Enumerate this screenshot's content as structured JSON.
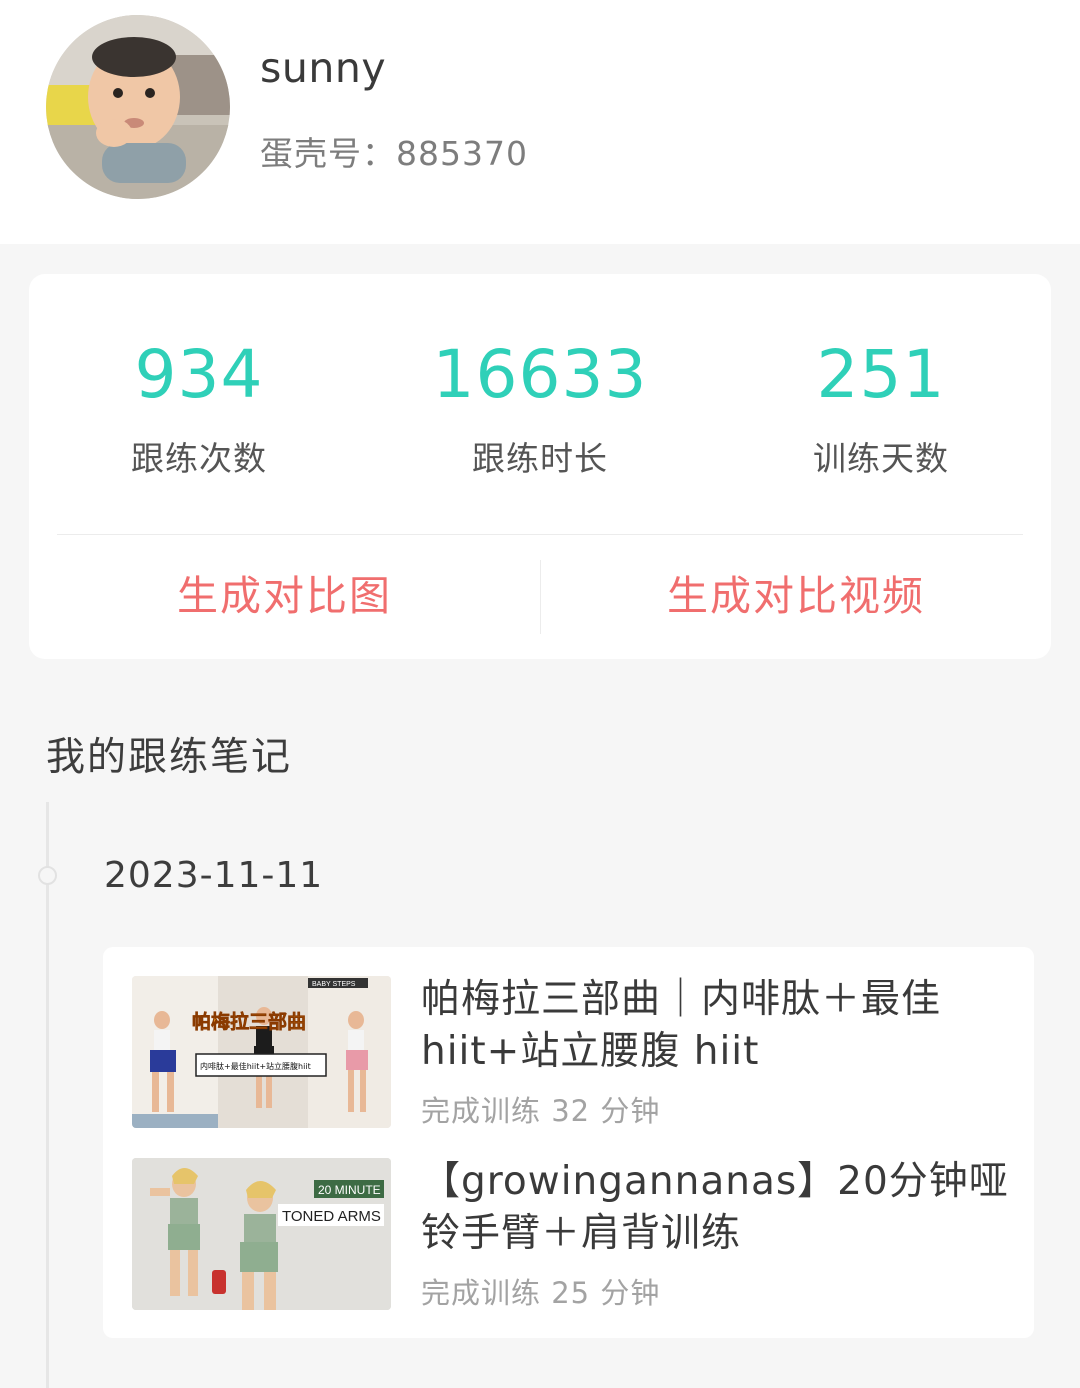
{
  "profile": {
    "username": "sunny",
    "id_text": "蛋壳号：885370"
  },
  "stats": [
    {
      "value": "934",
      "label": "跟练次数"
    },
    {
      "value": "16633",
      "label": "跟练时长"
    },
    {
      "value": "251",
      "label": "训练天数"
    }
  ],
  "actions": {
    "compare_image": "生成对比图",
    "compare_video": "生成对比视频"
  },
  "colors": {
    "accent_teal": "#2fd0b8",
    "action_red": "#f06e6e"
  },
  "notes": {
    "section_title": "我的跟练笔记",
    "date": "2023-11-11",
    "items": [
      {
        "title": "帕梅拉三部曲｜内啡肽＋最佳hiit+站立腰腹 hiit",
        "subtitle": "完成训练 32 分钟",
        "thumb_text": {
          "badge": "BABY STEPS",
          "headline": "帕梅拉三部曲",
          "caption": "内啡肽+最佳hiit+站立腰腹hiit"
        }
      },
      {
        "title": "【growingannanas】20分钟哑铃手臂＋肩背训练",
        "subtitle": "完成训练 25 分钟",
        "thumb_text": {
          "badge": "20 MINUTE",
          "headline": "TONED ARMS"
        }
      }
    ]
  }
}
